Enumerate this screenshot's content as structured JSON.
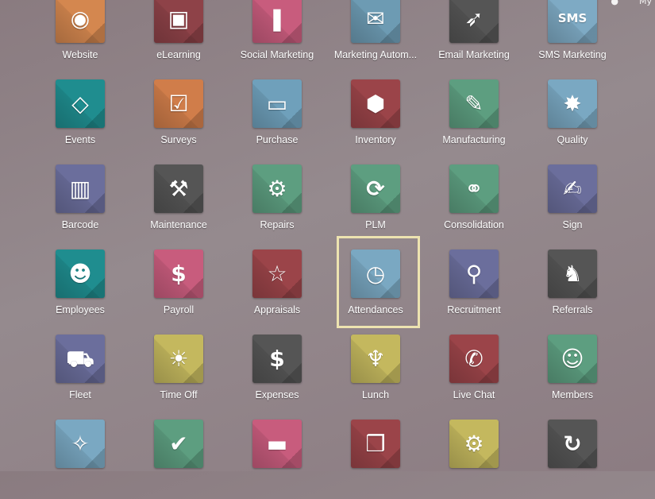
{
  "topbar": {
    "user_label": "My"
  },
  "highlighted_app": "Attendances",
  "highlight_color": "#ede3b0",
  "apps": [
    {
      "label": "Website",
      "icon": "globe-icon",
      "glyph": "◉",
      "color": "#d4874f"
    },
    {
      "label": "eLearning",
      "icon": "teacher-board-icon",
      "glyph": "▣",
      "color": "#8e4248"
    },
    {
      "label": "Social Marketing",
      "icon": "thumbs-up-icon",
      "glyph": "❚",
      "color": "#c85c7d"
    },
    {
      "label": "Marketing Autom...",
      "icon": "gear-envelope-icon",
      "glyph": "✉",
      "color": "#6d9bb3"
    },
    {
      "label": "Email Marketing",
      "icon": "paper-plane-icon",
      "glyph": "➶",
      "color": "#555555"
    },
    {
      "label": "SMS Marketing",
      "icon": "sms-phone-icon",
      "glyph": "SMS",
      "color": "#7eaac4"
    },
    {
      "label": "Events",
      "icon": "ticket-icon",
      "glyph": "◇",
      "color": "#1f8d8f"
    },
    {
      "label": "Surveys",
      "icon": "checklist-icon",
      "glyph": "☑",
      "color": "#d07d4a"
    },
    {
      "label": "Purchase",
      "icon": "credit-card-icon",
      "glyph": "▭",
      "color": "#6fa0bb"
    },
    {
      "label": "Inventory",
      "icon": "box-icon",
      "glyph": "⬢",
      "color": "#9b4449"
    },
    {
      "label": "Manufacturing",
      "icon": "wrench-icon",
      "glyph": "✎",
      "color": "#5d9e80"
    },
    {
      "label": "Quality",
      "icon": "badge-check-icon",
      "glyph": "✸",
      "color": "#7aa8c2"
    },
    {
      "label": "Barcode",
      "icon": "barcode-box-icon",
      "glyph": "▥",
      "color": "#6b6e9c"
    },
    {
      "label": "Maintenance",
      "icon": "hammer-icon",
      "glyph": "⚒",
      "color": "#555555"
    },
    {
      "label": "Repairs",
      "icon": "wrench-gear-icon",
      "glyph": "⚙",
      "color": "#5d9e80"
    },
    {
      "label": "PLM",
      "icon": "cycle-box-icon",
      "glyph": "⟳",
      "color": "#5d9e80"
    },
    {
      "label": "Consolidation",
      "icon": "overlap-circles-icon",
      "glyph": "⚭",
      "color": "#5d9e80"
    },
    {
      "label": "Sign",
      "icon": "sign-document-icon",
      "glyph": "✍",
      "color": "#6b6e9c"
    },
    {
      "label": "Employees",
      "icon": "users-icon",
      "glyph": "☻",
      "color": "#1f8d8f"
    },
    {
      "label": "Payroll",
      "icon": "user-money-icon",
      "glyph": "$",
      "color": "#c85c7d"
    },
    {
      "label": "Appraisals",
      "icon": "star-icon",
      "glyph": "☆",
      "color": "#9b4449"
    },
    {
      "label": "Attendances",
      "icon": "user-clock-icon",
      "glyph": "◷",
      "color": "#7aa8c2"
    },
    {
      "label": "Recruitment",
      "icon": "magnifier-user-icon",
      "glyph": "⚲",
      "color": "#6b6e9c"
    },
    {
      "label": "Referrals",
      "icon": "hero-cape-icon",
      "glyph": "♞",
      "color": "#555555"
    },
    {
      "label": "Fleet",
      "icon": "car-icon",
      "glyph": "⛟",
      "color": "#6b6e9c"
    },
    {
      "label": "Time Off",
      "icon": "user-sun-icon",
      "glyph": "☀",
      "color": "#c4b85e"
    },
    {
      "label": "Expenses",
      "icon": "user-dollar-icon",
      "glyph": "$",
      "color": "#555555"
    },
    {
      "label": "Lunch",
      "icon": "fork-knife-icon",
      "glyph": "♆",
      "color": "#c4b85e"
    },
    {
      "label": "Live Chat",
      "icon": "chat-bubbles-icon",
      "glyph": "✆",
      "color": "#9b4449"
    },
    {
      "label": "Members",
      "icon": "user-icon",
      "glyph": "☺",
      "color": "#5d9e80"
    },
    {
      "label": "",
      "icon": "broom-data-icon",
      "glyph": "✧",
      "color": "#7aa8c2"
    },
    {
      "label": "",
      "icon": "user-check-icon",
      "glyph": "✔",
      "color": "#5d9e80"
    },
    {
      "label": "",
      "icon": "rfid-card-icon",
      "glyph": "▬",
      "color": "#c85c7d"
    },
    {
      "label": "",
      "icon": "cubes-icon",
      "glyph": "❒",
      "color": "#9b4449"
    },
    {
      "label": "",
      "icon": "gear-icon",
      "glyph": "⚙",
      "color": "#c4b85e"
    },
    {
      "label": "",
      "icon": "refresh-alert-icon",
      "glyph": "↻",
      "color": "#555555"
    }
  ]
}
